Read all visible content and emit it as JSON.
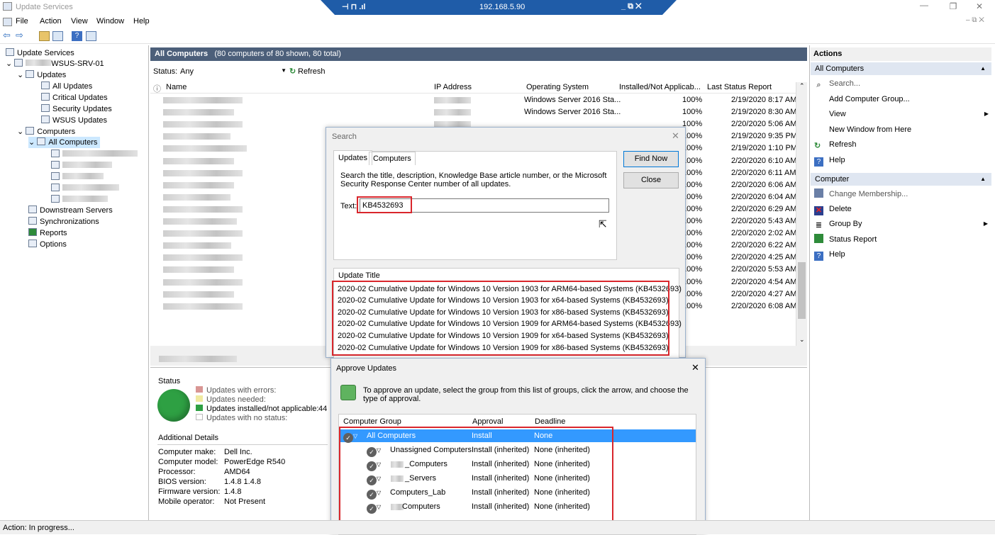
{
  "window": {
    "title": "Update Services",
    "rdp_host": "192.168.5.90",
    "min": "—",
    "max": "❐",
    "close": "✕"
  },
  "menu": {
    "items": [
      "File",
      "Action",
      "View",
      "Window",
      "Help"
    ]
  },
  "tree": {
    "root": "Update Services",
    "server": "WSUS-SRV-01",
    "updates": "Updates",
    "update_children": [
      "All Updates",
      "Critical Updates",
      "Security Updates",
      "WSUS Updates"
    ],
    "computers": "Computers",
    "all_computers": "All Computers",
    "bottom": [
      "Downstream Servers",
      "Synchronizations",
      "Reports",
      "Options"
    ]
  },
  "center": {
    "header_title": "All Computers",
    "header_count": "(80 computers of 80 shown, 80 total)",
    "status_label": "Status:",
    "status_value": "Any",
    "refresh_label": "Refresh",
    "columns": [
      "Name",
      "IP Address",
      "Operating System",
      "Installed/Not Applicab...",
      "Last Status Report"
    ],
    "rows": [
      {
        "os": "Windows Server 2016 Sta...",
        "pct": "100%",
        "date": "2/19/2020 8:17 AM"
      },
      {
        "os": "Windows Server 2016 Sta...",
        "pct": "100%",
        "date": "2/19/2020 8:30 AM"
      },
      {
        "os": "",
        "pct": "100%",
        "date": "2/20/2020 5:06 AM"
      },
      {
        "os": "",
        "pct": "100%",
        "date": "2/19/2020 9:35 PM"
      },
      {
        "os": "",
        "pct": "100%",
        "date": "2/19/2020 1:10 PM"
      },
      {
        "os": "",
        "pct": "100%",
        "date": "2/20/2020 6:10 AM"
      },
      {
        "os": "",
        "pct": "100%",
        "date": "2/20/2020 6:11 AM"
      },
      {
        "os": "",
        "pct": "100%",
        "date": "2/20/2020 6:06 AM"
      },
      {
        "os": "",
        "pct": "100%",
        "date": "2/20/2020 6:04 AM"
      },
      {
        "os": "",
        "pct": "100%",
        "date": "2/20/2020 6:29 AM"
      },
      {
        "os": "",
        "pct": "100%",
        "date": "2/20/2020 5:43 AM"
      },
      {
        "os": "",
        "pct": "100%",
        "date": "2/20/2020 2:02 AM"
      },
      {
        "os": "",
        "pct": "100%",
        "date": "2/20/2020 6:22 AM"
      },
      {
        "os": "",
        "pct": "100%",
        "date": "2/20/2020 4:25 AM"
      },
      {
        "os": "",
        "pct": "100%",
        "date": "2/20/2020 5:53 AM"
      },
      {
        "os": "",
        "pct": "100%",
        "date": "2/20/2020 4:54 AM"
      },
      {
        "os": "",
        "pct": "100%",
        "date": "2/20/2020 4:27 AM"
      },
      {
        "os": "",
        "pct": "100%",
        "date": "2/20/2020 6:08 AM"
      }
    ],
    "status_title": "Status",
    "legend": [
      "Updates with errors:",
      "Updates needed:",
      "Updates installed/not applicable:",
      "Updates with no status:"
    ],
    "legend_value": "44",
    "additional_details": "Additional Details",
    "details": [
      {
        "k": "Computer make:",
        "v": "Dell Inc."
      },
      {
        "k": "Computer model:",
        "v": "PowerEdge R540"
      },
      {
        "k": "Processor:",
        "v": "AMD64"
      },
      {
        "k": "BIOS version:",
        "v": "1.4.8 1.4.8"
      },
      {
        "k": "Firmware version:",
        "v": "1.4.8"
      },
      {
        "k": "Mobile operator:",
        "v": "Not Present"
      }
    ]
  },
  "actions": {
    "title": "Actions",
    "sec1": "All Computers",
    "sec1_items": [
      "Search...",
      "Add Computer Group...",
      "View",
      "New Window from Here",
      "Refresh",
      "Help"
    ],
    "sec2": "Computer",
    "sec2_items": [
      "Change Membership...",
      "Delete",
      "Group By",
      "Status Report",
      "Help"
    ]
  },
  "search_dialog": {
    "title": "Search",
    "tab_updates": "Updates",
    "tab_computers": "Computers",
    "description": "Search the title, description, Knowledge Base article number, or the Microsoft Security Response Center number of all updates.",
    "text_label": "Text:",
    "text_value": "KB4532693",
    "find_now": "Find Now",
    "close": "Close",
    "result_header": "Update Title",
    "results": [
      "2020-02 Cumulative Update for Windows 10 Version 1903 for ARM64-based Systems (KB4532693)",
      "2020-02 Cumulative Update for Windows 10 Version 1903 for x64-based Systems (KB4532693)",
      "2020-02 Cumulative Update for Windows 10 Version 1903 for x86-based Systems (KB4532693)",
      "2020-02 Cumulative Update for Windows 10 Version 1909 for ARM64-based Systems (KB4532693)",
      "2020-02 Cumulative Update for Windows 10 Version 1909 for x64-based Systems (KB4532693)",
      "2020-02 Cumulative Update for Windows 10 Version 1909 for x86-based Systems (KB4532693)"
    ]
  },
  "approve_dialog": {
    "title": "Approve Updates",
    "instruction": "To approve an update, select the group from this list of groups, click the arrow, and choose the type of approval.",
    "columns": [
      "Computer Group",
      "Approval",
      "Deadline"
    ],
    "groups": [
      {
        "name": "All Computers",
        "approval": "Install",
        "deadline": "None"
      },
      {
        "name": "Unassigned Computers",
        "approval": "Install (inherited)",
        "deadline": "None (inherited)"
      },
      {
        "name": "_Computers",
        "approval": "Install (inherited)",
        "deadline": "None (inherited)"
      },
      {
        "name": "_Servers",
        "approval": "Install (inherited)",
        "deadline": "None (inherited)"
      },
      {
        "name": "Computers_Lab",
        "approval": "Install (inherited)",
        "deadline": "None (inherited)"
      },
      {
        "name": "Computers",
        "approval": "Install (inherited)",
        "deadline": "None (inherited)"
      }
    ]
  },
  "statusbar": {
    "text": "Action:  In progress..."
  },
  "colors": {
    "header": "#4c5f7a",
    "selection": "#3399ff",
    "highlight": "#d9262c",
    "status_green": "#2ea043"
  }
}
